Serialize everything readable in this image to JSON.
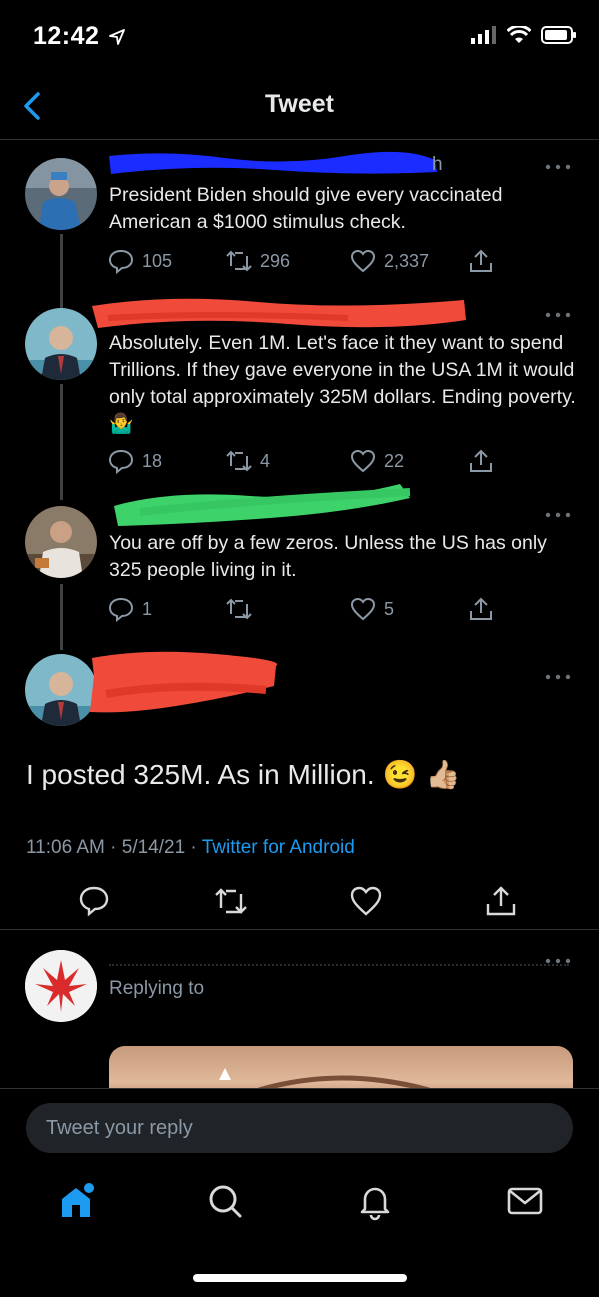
{
  "status": {
    "time": "12:42"
  },
  "nav": {
    "title": "Tweet"
  },
  "tweet1": {
    "name_suffix": "h",
    "text": "President Biden should give every vaccinated American a $1000 stimulus check.",
    "replies": "105",
    "retweets": "296",
    "likes": "2,337"
  },
  "tweet2": {
    "text": "Absolutely. Even 1M. Let's face it they want to spend Trillions. If they gave everyone in the USA 1M it would only total approximately 325M dollars. Ending poverty.",
    "emoji": "🤷‍♂️",
    "replies": "18",
    "retweets": "4",
    "likes": "22"
  },
  "tweet3": {
    "text": "You are off by a few zeros. Unless the US has only 325 people living in it.",
    "replies": "1",
    "retweets": "",
    "likes": "5"
  },
  "main_tweet": {
    "text": "I posted 325M. As in Million.",
    "emoji1": "😉",
    "emoji2": "👍🏼",
    "time": "11:06 AM · 5/14/21 · ",
    "source": "Twitter for Android"
  },
  "reply_preview": {
    "text": "Replying to"
  },
  "compose": {
    "placeholder": "Tweet your reply"
  },
  "colors": {
    "accent": "#1d9bf0",
    "background": "#000000",
    "muted": "#8b98a5",
    "redaction_blue": "#1a2cff",
    "redaction_red": "#f04a3a",
    "redaction_green": "#3dd36a"
  },
  "icons": [
    "back-icon",
    "more-icon",
    "reply-icon",
    "retweet-icon",
    "like-icon",
    "share-icon",
    "home-icon",
    "search-icon",
    "notifications-icon",
    "messages-icon"
  ]
}
